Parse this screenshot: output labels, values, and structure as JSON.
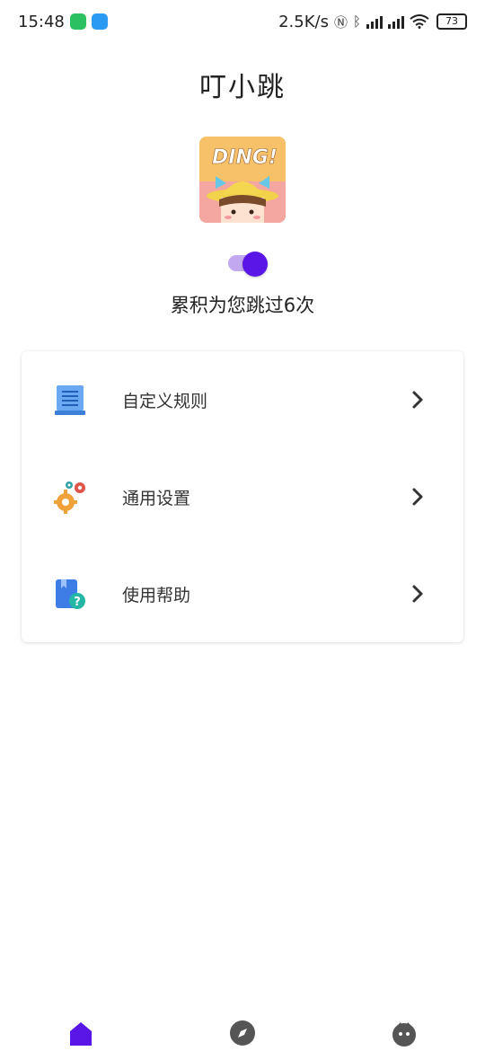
{
  "status_bar": {
    "time": "15:48",
    "network_speed": "2.5K/s",
    "battery": "73",
    "icons": [
      "wechat-icon",
      "cloud-icon",
      "nfc-icon",
      "bluetooth-icon",
      "signal-icon",
      "wifi-icon",
      "battery-icon"
    ]
  },
  "app": {
    "title": "叮小跳",
    "logo_text": "DING!",
    "service_enabled": true,
    "skip_count_text": "累积为您跳过6次"
  },
  "menu": {
    "items": [
      {
        "label": "自定义规则",
        "icon": "rules-document-icon"
      },
      {
        "label": "通用设置",
        "icon": "gears-icon"
      },
      {
        "label": "使用帮助",
        "icon": "help-book-icon"
      }
    ]
  },
  "bottom_nav": {
    "items": [
      {
        "icon": "home-icon",
        "active": true
      },
      {
        "icon": "compass-icon",
        "active": false
      },
      {
        "icon": "profile-icon",
        "active": false
      }
    ],
    "active_color": "#5a16e6",
    "inactive_color": "#555555"
  },
  "colors": {
    "accent": "#5a16e6",
    "toggle_track": "#c2a9ef"
  }
}
